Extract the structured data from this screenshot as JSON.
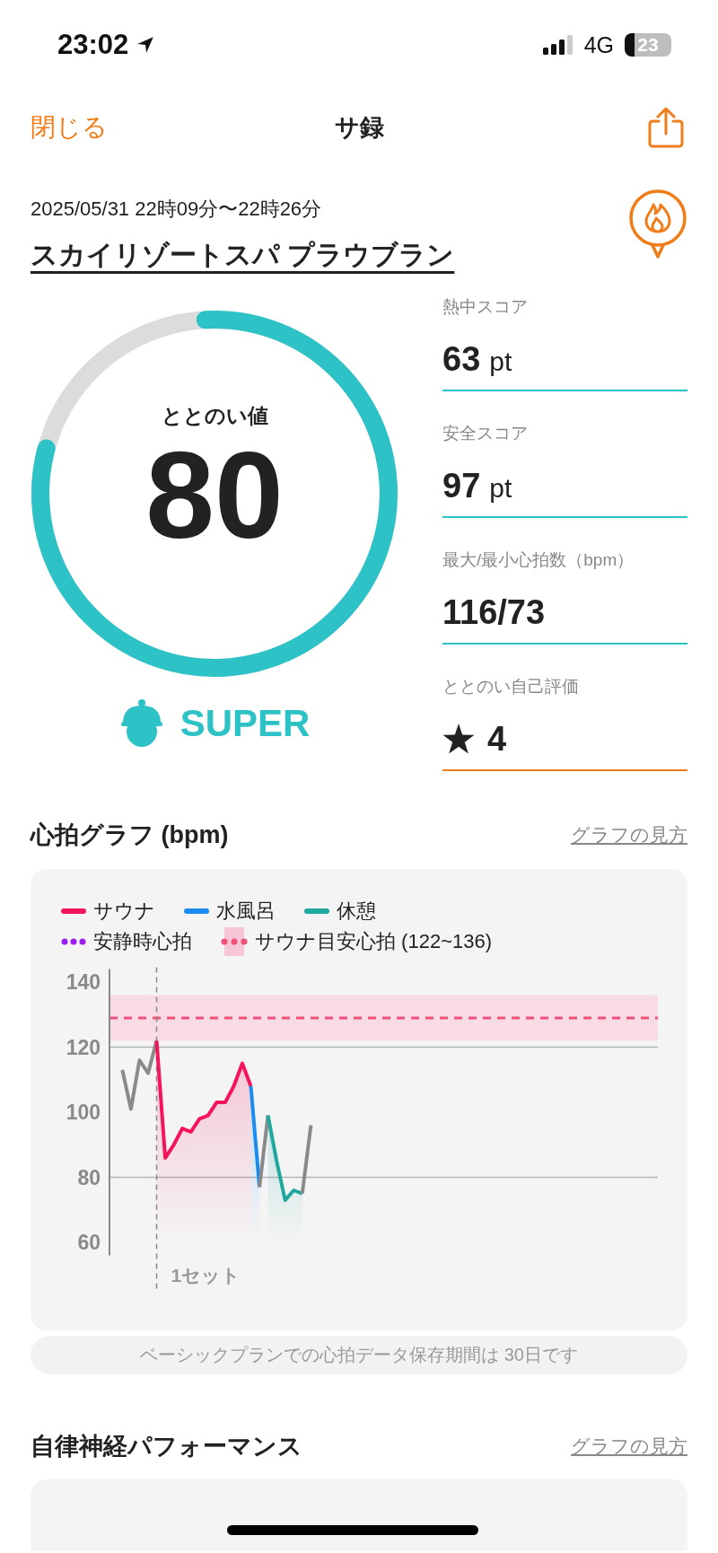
{
  "status_bar": {
    "time": "23:02",
    "network": "4G",
    "battery": "23"
  },
  "nav": {
    "close": "閉じる",
    "title": "サ録"
  },
  "session": {
    "date": "2025/05/31 22時09分〜22時26分",
    "venue": "スカイリゾートスパ プラウブラン"
  },
  "score": {
    "label": "ととのい値",
    "value": "80",
    "level": 0.8,
    "rank": "SUPER"
  },
  "stats": [
    {
      "kind": "score",
      "label": "熱中スコア",
      "value": "63",
      "unit": "pt"
    },
    {
      "kind": "score",
      "label": "安全スコア",
      "value": "97",
      "unit": "pt"
    },
    {
      "kind": "score",
      "label": "最大/最小心拍数（bpm）",
      "value": "116/73"
    },
    {
      "kind": "rating",
      "label": "ととのい自己評価",
      "value": "4"
    }
  ],
  "heart_section": {
    "title": "心拍グラフ (bpm)",
    "link": "グラフの見方",
    "legend": [
      {
        "kind": "dots",
        "label": "安静時心拍",
        "color": "#9b1ff0"
      },
      {
        "kind": "band-dots",
        "label": "サウナ目安心拍 (122~136)",
        "color": "#f0507a"
      }
    ],
    "chart_data": {
      "type": "line",
      "ylim": [
        56,
        144
      ],
      "yticks": [
        60,
        80,
        100,
        120,
        140
      ],
      "categories": [
        null,
        null,
        null,
        null,
        null,
        null,
        null,
        null,
        null,
        null,
        null,
        null,
        null,
        null,
        null,
        null,
        null,
        null,
        null,
        null,
        null,
        null,
        null,
        null,
        null,
        null,
        null,
        null,
        null,
        null,
        null,
        null,
        null,
        null,
        null,
        null,
        null,
        null,
        null,
        null,
        null,
        null,
        null,
        null,
        null,
        null,
        null,
        null,
        null,
        null,
        null,
        null,
        null,
        null,
        null,
        null,
        null,
        null,
        null,
        null,
        null,
        null,
        null,
        null
      ],
      "series": [
        {
          "color": "#8a8a8a",
          "values": [
            null,
            113,
            101,
            116,
            112,
            122,
            null,
            null,
            null,
            null,
            null,
            null,
            null,
            null,
            null,
            null,
            null,
            null,
            null,
            null,
            null,
            null,
            null,
            null,
            null,
            null,
            null,
            null,
            null,
            null,
            null,
            null,
            null,
            null,
            null,
            null,
            null,
            null,
            null,
            null,
            null,
            null,
            null,
            null,
            null,
            null,
            null,
            null,
            null,
            null,
            null,
            null,
            null,
            null,
            null,
            null,
            null,
            null,
            null,
            null,
            null,
            null,
            null,
            null
          ]
        },
        {
          "name": "サウナ",
          "color": "#f5145a",
          "values": [
            null,
            null,
            null,
            null,
            null,
            122,
            86,
            90,
            95,
            94,
            98,
            99,
            103,
            103,
            108,
            115,
            108,
            null,
            null,
            null,
            null,
            null,
            null,
            null,
            null,
            null,
            null,
            null,
            null,
            null,
            null,
            null,
            null,
            null,
            null,
            null,
            null,
            null,
            null,
            null,
            null,
            null,
            null,
            null,
            null,
            null,
            null,
            null,
            null,
            null,
            null,
            null,
            null,
            null,
            null,
            null,
            null,
            null,
            null,
            null,
            null,
            null,
            null,
            null
          ]
        },
        {
          "name": "水風呂",
          "color": "#1a8cf0",
          "values": [
            null,
            null,
            null,
            null,
            null,
            null,
            null,
            null,
            null,
            null,
            null,
            null,
            null,
            null,
            null,
            null,
            108,
            77,
            null,
            null,
            null,
            null,
            null,
            null,
            null,
            null,
            null,
            null,
            null,
            null,
            null,
            null,
            null,
            null,
            null,
            null,
            null,
            null,
            null,
            null,
            null,
            null,
            null,
            null,
            null,
            null,
            null,
            null,
            null,
            null,
            null,
            null,
            null,
            null,
            null,
            null,
            null,
            null,
            null,
            null,
            null,
            null,
            null,
            null
          ]
        },
        {
          "color": "#8a8a8a",
          "values": [
            null,
            null,
            null,
            null,
            null,
            null,
            null,
            null,
            null,
            null,
            null,
            null,
            null,
            null,
            null,
            null,
            null,
            77,
            99,
            null,
            null,
            null,
            null,
            null,
            null,
            null,
            null,
            null,
            null,
            null,
            null,
            null,
            null,
            null,
            null,
            null,
            null,
            null,
            null,
            null,
            null,
            null,
            null,
            null,
            null,
            null,
            null,
            null,
            null,
            null,
            null,
            null,
            null,
            null,
            null,
            null,
            null,
            null,
            null,
            null,
            null,
            null,
            null,
            null
          ]
        },
        {
          "name": "休憩",
          "color": "#1fa8a0",
          "values": [
            null,
            null,
            null,
            null,
            null,
            null,
            null,
            null,
            null,
            null,
            null,
            null,
            null,
            null,
            null,
            null,
            null,
            null,
            99,
            85,
            73,
            76,
            75,
            null,
            null,
            null,
            null,
            null,
            null,
            null,
            null,
            null,
            null,
            null,
            null,
            null,
            null,
            null,
            null,
            null,
            null,
            null,
            null,
            null,
            null,
            null,
            null,
            null,
            null,
            null,
            null,
            null,
            null,
            null,
            null,
            null,
            null,
            null,
            null,
            null,
            null,
            null,
            null,
            null
          ]
        },
        {
          "color": "#8a8a8a",
          "values": [
            null,
            null,
            null,
            null,
            null,
            null,
            null,
            null,
            null,
            null,
            null,
            null,
            null,
            null,
            null,
            null,
            null,
            null,
            null,
            null,
            null,
            null,
            75,
            96,
            null,
            null,
            null,
            null,
            null,
            null,
            null,
            null,
            null,
            null,
            null,
            null,
            null,
            null,
            null,
            null,
            null,
            null,
            null,
            null,
            null,
            null,
            null,
            null,
            null,
            null,
            null,
            null,
            null,
            null,
            null,
            null,
            null,
            null,
            null,
            null,
            null,
            null,
            null,
            null
          ]
        }
      ],
      "bands": [
        {
          "axis": "y",
          "from": 122,
          "to": 136
        }
      ],
      "ref_lines": [
        {
          "axis": "y",
          "value": 129
        }
      ],
      "annotations": [
        "1セット"
      ]
    },
    "notice": "ベーシックプランでの心拍データ保存期間は 30日です"
  },
  "autonomic_section": {
    "title": "自律神経パフォーマンス",
    "link": "グラフの見方"
  }
}
